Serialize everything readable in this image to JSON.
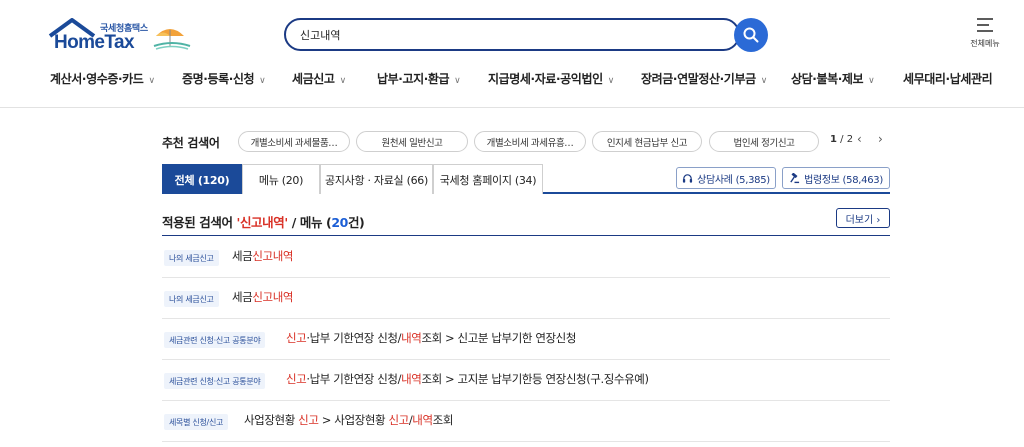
{
  "header": {
    "logo_top": "국세청홈택스",
    "logo_main": "HomeTax",
    "search_value": "신고내역",
    "allmenu_label": "전체메뉴"
  },
  "gnb": [
    {
      "label": "계산서·영수증·카드"
    },
    {
      "label": "증명·등록·신청"
    },
    {
      "label": "세금신고"
    },
    {
      "label": "납부·고지·환급"
    },
    {
      "label": "지급명세·자료·공익법인"
    },
    {
      "label": "장려금·연말정산·기부금"
    },
    {
      "label": "상담·불복·제보"
    },
    {
      "label": "세무대리·납세관리"
    }
  ],
  "recommend": {
    "label": "추천 검색어",
    "chips": [
      "개별소비세 과세물품…",
      "원천세 일반신고",
      "개별소비세 과세유흥…",
      "인지세 현금납부 신고",
      "법인세 정기신고"
    ],
    "page_current": "1",
    "page_sep": " / ",
    "page_total": "2",
    "prev": "‹",
    "next": "›"
  },
  "tabs": [
    {
      "label": "전체 (120)",
      "active": true
    },
    {
      "label": "메뉴 (20)",
      "active": false
    },
    {
      "label": "공지사항 · 자료실 (66)",
      "active": false
    },
    {
      "label": "국세청 홈페이지 (34)",
      "active": false
    }
  ],
  "tools": {
    "counsel": "상담사례 (5,385)",
    "law": "법령정보 (58,463)"
  },
  "result": {
    "prefix": "적용된 검색어 ",
    "keyword": "'신고내역'",
    "middle": " / 메뉴 (",
    "count": "20",
    "suffix": "건)",
    "more": "더보기 ›"
  },
  "rows": [
    {
      "badge": "나의 세금신고",
      "parts": [
        "세금",
        "신고내역",
        ""
      ]
    },
    {
      "badge": "나의 세금신고",
      "parts": [
        "세금",
        "신고내역",
        ""
      ]
    },
    {
      "badge": "세금관련 신청·신고 공통분야",
      "parts": [
        "",
        "신고",
        "·납부 기한연장 신청/",
        "내역",
        "조회 > 신고분 납부기한 연장신청"
      ]
    },
    {
      "badge": "세금관련 신청·신고 공통분야",
      "parts": [
        "",
        "신고",
        "·납부 기한연장 신청/",
        "내역",
        "조회 > 고지분 납부기한등 연장신청(구.징수유예)"
      ]
    },
    {
      "badge": "세목별 신청/신고",
      "parts": [
        "사업장현황 ",
        "신고",
        " > 사업장현황 ",
        "신고",
        "/",
        "내역",
        "조회"
      ]
    }
  ]
}
